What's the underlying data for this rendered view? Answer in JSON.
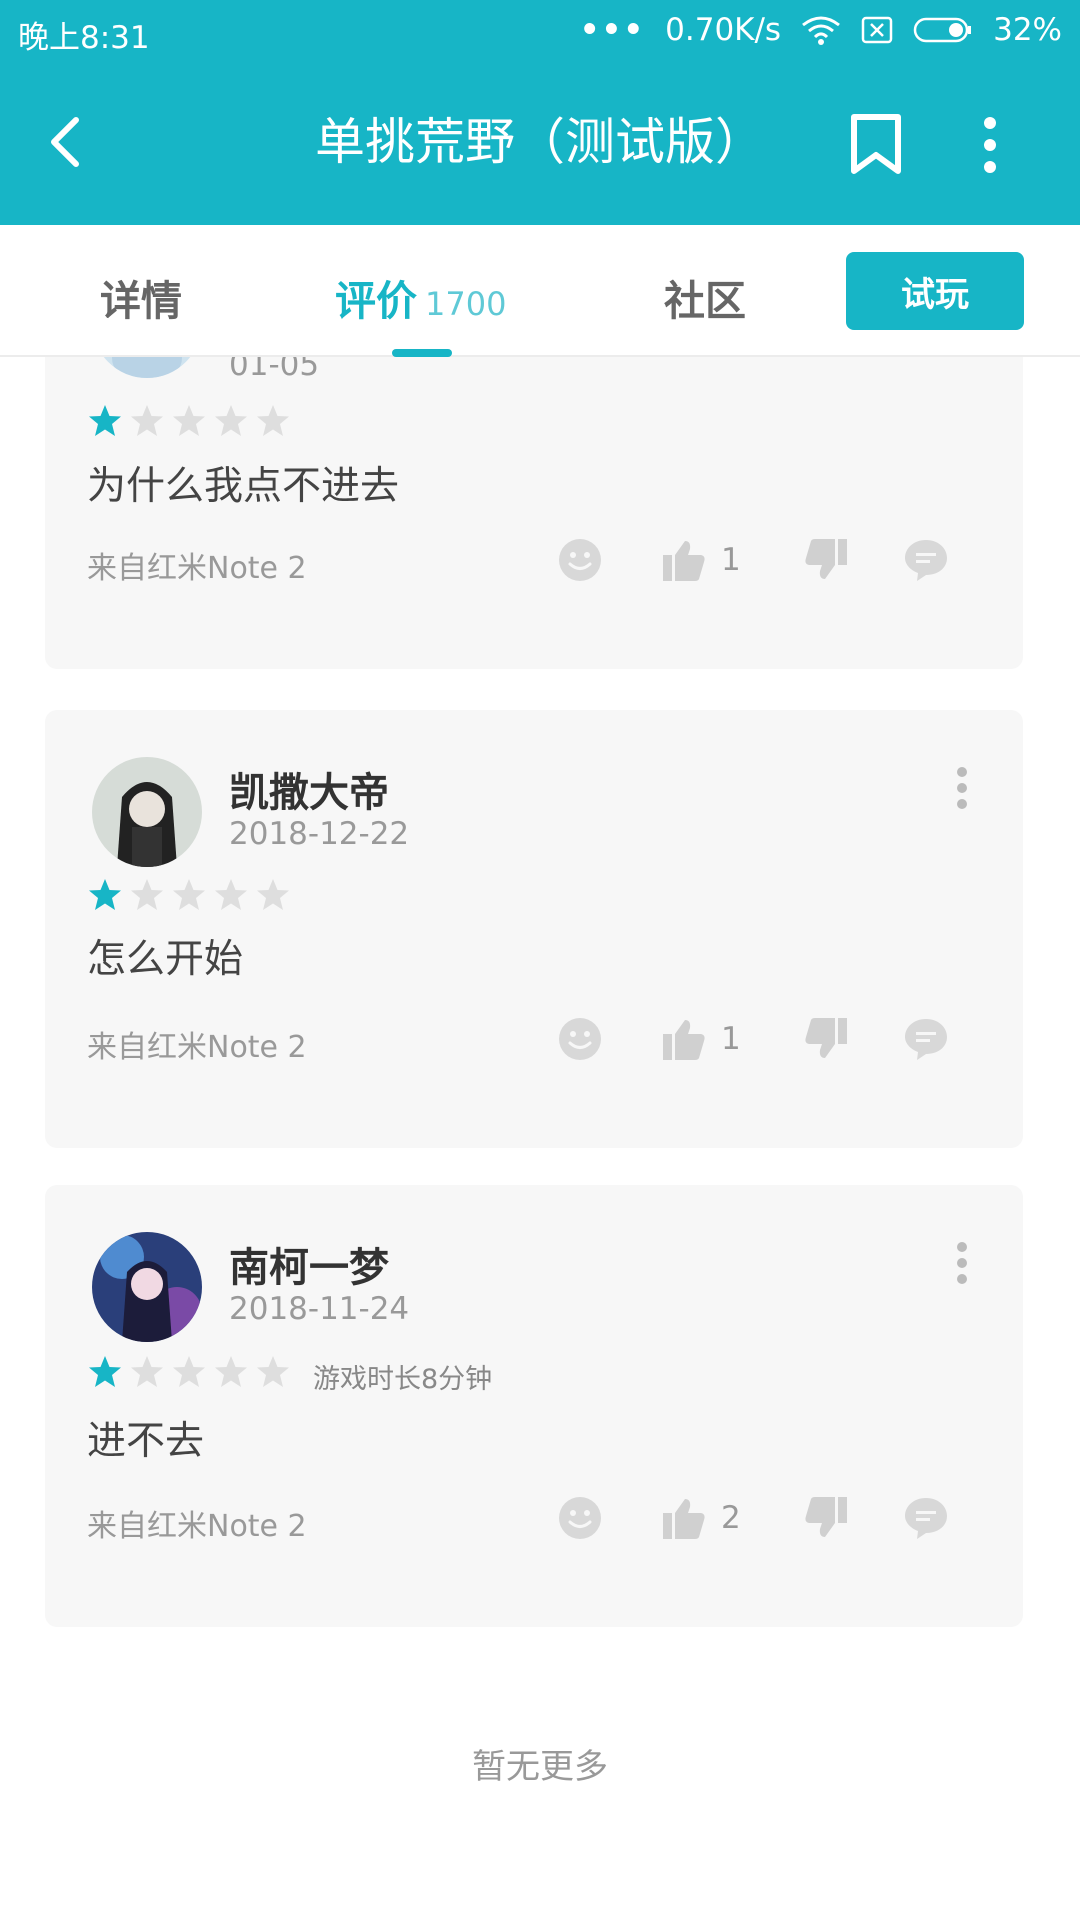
{
  "status_bar": {
    "time": "晚上8:31",
    "network_speed": "0.70K/s",
    "battery": "32%"
  },
  "app_bar": {
    "title": "单挑荒野（测试版）"
  },
  "tabs": [
    {
      "label": "详情"
    },
    {
      "label": "评价",
      "count": "1700"
    },
    {
      "label": "社区"
    }
  ],
  "try_button": "试玩",
  "accent_color": "#17b5c6",
  "reviews": [
    {
      "date": "01-05",
      "rating": 1,
      "content": "为什么我点不进去",
      "device": "来自红米Note 2",
      "likes": "1"
    },
    {
      "name": "凯撒大帝",
      "date": "2018-12-22",
      "rating": 1,
      "content": "怎么开始",
      "device": "来自红米Note 2",
      "likes": "1"
    },
    {
      "name": "南柯一梦",
      "date": "2018-11-24",
      "rating": 1,
      "playtime": "游戏时长8分钟",
      "content": "进不去",
      "device": "来自红米Note 2",
      "likes": "2"
    }
  ],
  "footer": "暂无更多"
}
